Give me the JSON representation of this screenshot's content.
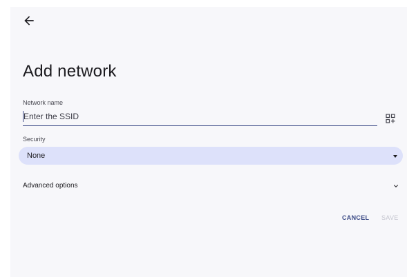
{
  "header": {
    "back_icon": "arrow-back-icon"
  },
  "page": {
    "title": "Add network"
  },
  "ssid": {
    "label": "Network name",
    "placeholder": "Enter the SSID",
    "value": "",
    "scan_icon": "qr-code-scanner-icon"
  },
  "security": {
    "label": "Security",
    "selected": "None",
    "dropdown_icon": "arrow-drop-down-icon"
  },
  "advanced": {
    "label": "Advanced options",
    "expand_icon": "chevron-down-icon"
  },
  "actions": {
    "cancel_label": "CANCEL",
    "save_label": "SAVE",
    "save_enabled": false
  },
  "colors": {
    "background": "#f7f7fa",
    "accent": "#3c4b86",
    "select_fill": "#dde1fa",
    "disabled_text": "#c4c5cf"
  }
}
